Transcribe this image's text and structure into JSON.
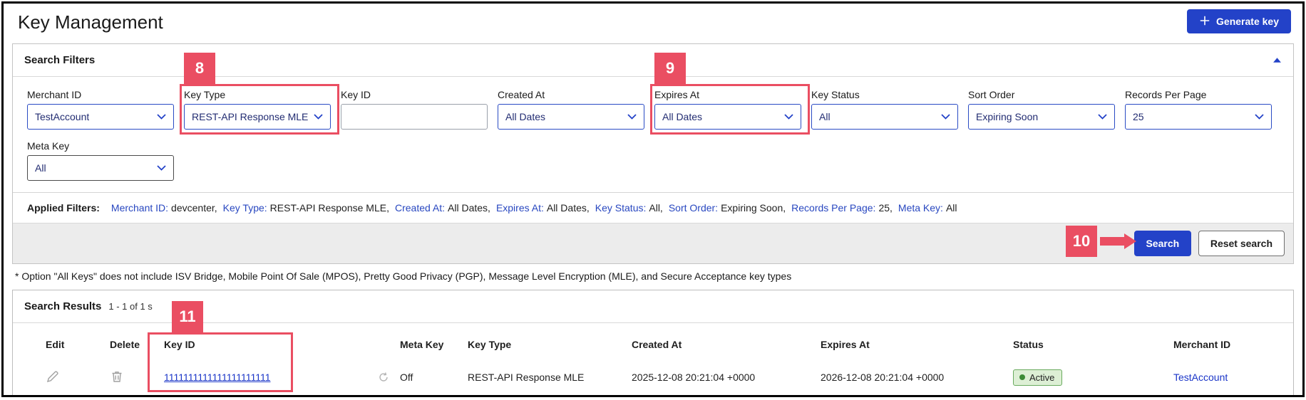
{
  "page": {
    "title": "Key Management"
  },
  "header": {
    "generate_key_label": "Generate key"
  },
  "colors": {
    "accent_blue": "#2342c8",
    "annotation_red": "#ea4e62",
    "link_blue": "#1a35c8",
    "status_green": "#3d8b37"
  },
  "filters": {
    "panel_title": "Search Filters",
    "fields": [
      {
        "label": "Merchant ID",
        "value": "TestAccount"
      },
      {
        "label": "Key Type",
        "value": "REST-API Response MLE"
      },
      {
        "label": "Key ID",
        "value": ""
      },
      {
        "label": "Created At",
        "value": "All Dates"
      },
      {
        "label": "Expires At",
        "value": "All Dates"
      },
      {
        "label": "Key Status",
        "value": "All"
      },
      {
        "label": "Sort Order",
        "value": "Expiring Soon"
      },
      {
        "label": "Records Per Page",
        "value": "25"
      }
    ],
    "meta_key": {
      "label": "Meta Key",
      "value": "All"
    },
    "applied": {
      "heading": "Applied Filters:",
      "items": [
        {
          "label": "Merchant ID:",
          "value": "devcenter,"
        },
        {
          "label": "Key Type:",
          "value": "REST-API Response MLE,"
        },
        {
          "label": "Created At:",
          "value": "All Dates,"
        },
        {
          "label": "Expires At:",
          "value": "All Dates,"
        },
        {
          "label": "Key Status:",
          "value": "All,"
        },
        {
          "label": "Sort Order:",
          "value": "Expiring Soon,"
        },
        {
          "label": "Records Per Page:",
          "value": "25,"
        },
        {
          "label": "Meta Key:",
          "value": "All"
        }
      ]
    },
    "search_label": "Search",
    "reset_label": "Reset search"
  },
  "footnote": "* Option \"All Keys\" does not include ISV Bridge, Mobile Point Of Sale (MPOS), Pretty Good Privacy (PGP), Message Level Encryption (MLE), and Secure Acceptance key types",
  "results": {
    "panel_title": "Search Results",
    "count_text": "1 - 1 of 1 s",
    "columns": {
      "edit": "Edit",
      "delete": "Delete",
      "key_id": "Key ID",
      "meta_key": "Meta Key",
      "key_type": "Key Type",
      "created_at": "Created At",
      "expires_at": "Expires At",
      "status": "Status",
      "merchant_id": "Merchant ID"
    },
    "row": {
      "key_id": "1111111111111111111111",
      "meta_key": "Off",
      "key_type": "REST-API Response MLE",
      "created_at": "2025-12-08 20:21:04 +0000",
      "expires_at": "2026-12-08 20:21:04 +0000",
      "status": "Active",
      "merchant_id": "TestAccount"
    }
  },
  "annotations": {
    "badge8": "8",
    "badge9": "9",
    "badge10": "10",
    "badge11": "11"
  }
}
